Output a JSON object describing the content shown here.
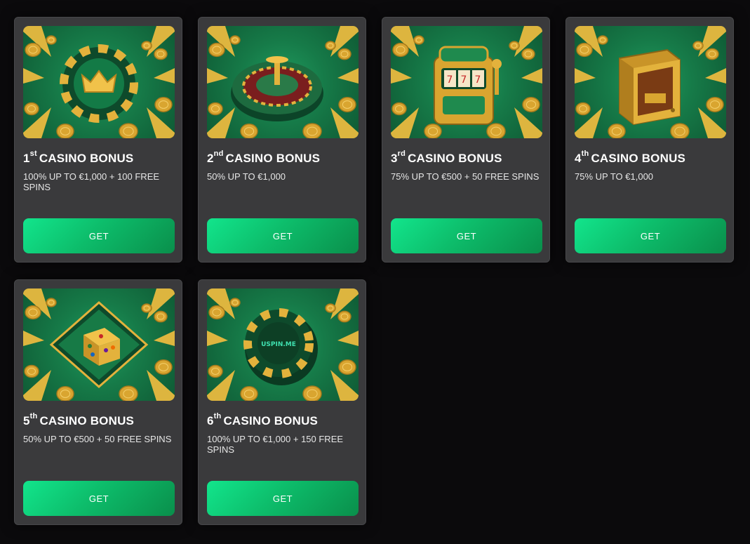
{
  "bonuses": [
    {
      "num": "1",
      "suffix": "st",
      "title": "CASINO BONUS",
      "desc": "100% UP TO €1,000 + 100 FREE SPINS",
      "button": "GET",
      "art_icon": "crown-chip-icon"
    },
    {
      "num": "2",
      "suffix": "nd",
      "title": "CASINO BONUS",
      "desc": "50% UP TO €1,000",
      "button": "GET",
      "art_icon": "roulette-wheel-icon"
    },
    {
      "num": "3",
      "suffix": "rd",
      "title": "CASINO BONUS",
      "desc": "75% UP TO €500 + 50 FREE SPINS",
      "button": "GET",
      "art_icon": "slot-machine-icon"
    },
    {
      "num": "4",
      "suffix": "th",
      "title": "CASINO BONUS",
      "desc": "75% UP TO €1,000",
      "button": "GET",
      "art_icon": "safe-icon"
    },
    {
      "num": "5",
      "suffix": "th",
      "title": "CASINO BONUS",
      "desc": "50% UP TO €500 + 50 FREE SPINS",
      "button": "GET",
      "art_icon": "dice-icon"
    },
    {
      "num": "6",
      "suffix": "th",
      "title": "CASINO BONUS",
      "desc": "100% UP TO €1,000 + 150 FREE SPINS",
      "button": "GET",
      "art_icon": "uspin-chip-icon"
    }
  ],
  "chip_logo_text": "USPIN.ME",
  "colors": {
    "background": "#0b0a0c",
    "card": "#3a3a3c",
    "accent_green": "#12e58c",
    "art_green": "#167a48",
    "gold": "#e3b23c"
  }
}
